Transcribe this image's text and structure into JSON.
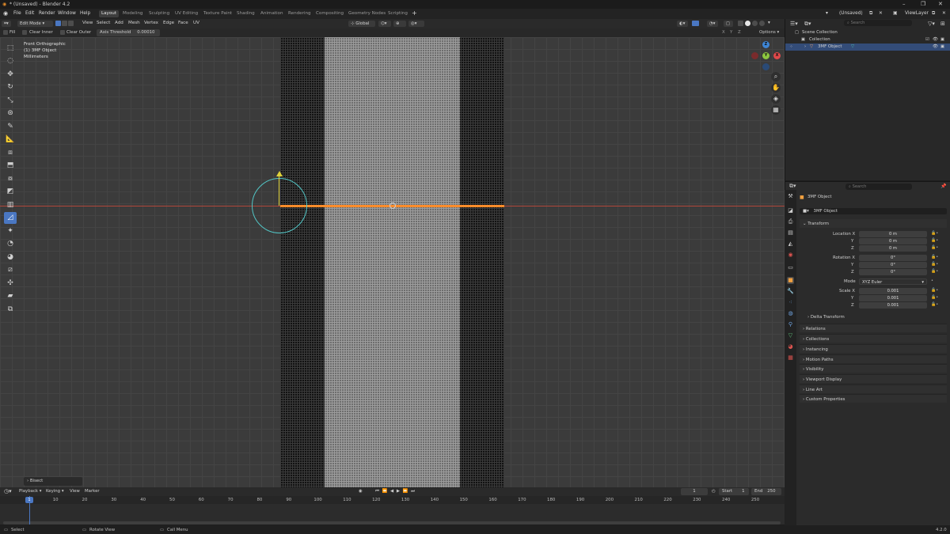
{
  "app": {
    "title": "* (Unsaved) - Blender 4.2",
    "version": "4.2.0"
  },
  "menu": [
    "File",
    "Edit",
    "Render",
    "Window",
    "Help"
  ],
  "workspaces": [
    "Layout",
    "Modeling",
    "Sculpting",
    "UV Editing",
    "Texture Paint",
    "Shading",
    "Animation",
    "Rendering",
    "Compositing",
    "Geometry Nodes",
    "Scripting"
  ],
  "active_workspace": "Layout",
  "scene": {
    "name": "(Unsaved)",
    "view_layer": "ViewLayer"
  },
  "viewport_header": {
    "mode": "Edit Mode",
    "menus": [
      "View",
      "Select",
      "Add",
      "Mesh",
      "Vertex",
      "Edge",
      "Face",
      "UV"
    ],
    "orientation": "Global",
    "options": "Options",
    "axes": [
      "X",
      "Y",
      "Z"
    ]
  },
  "tool_settings": {
    "fill": "Fill",
    "clear_inner": "Clear Inner",
    "clear_outer": "Clear Outer",
    "axis_threshold_label": "Axis Threshold",
    "axis_threshold_value": "0.00010"
  },
  "viewport_info": {
    "view": "Front Orthographic",
    "object": "(1) 3MF Object",
    "units": "Millimeters"
  },
  "operator_panel": "Bisect",
  "nav_axes": {
    "z": "Z",
    "y": "Y",
    "x": "X"
  },
  "timeline": {
    "menus": [
      "Playback",
      "Keying",
      "View",
      "Marker"
    ],
    "current_frame": "1",
    "start_label": "Start",
    "start": "1",
    "end_label": "End",
    "end": "250",
    "ruler": [
      "1",
      "10",
      "20",
      "30",
      "40",
      "50",
      "60",
      "70",
      "80",
      "90",
      "100",
      "110",
      "120",
      "130",
      "140",
      "150",
      "160",
      "170",
      "180",
      "190",
      "200",
      "210",
      "220",
      "230",
      "240",
      "250"
    ]
  },
  "statusbar": {
    "select": "Select",
    "rotate": "Rotate View",
    "call_menu": "Call Menu",
    "version": "4.2.0"
  },
  "outliner": {
    "search_placeholder": "Search",
    "scene_collection": "Scene Collection",
    "collection": "Collection",
    "object": "3MF Object"
  },
  "properties": {
    "search_placeholder": "Search",
    "object_name": "3MF Object",
    "object_field": "3MF Object",
    "transform": "Transform",
    "location_label": "Location X",
    "rotation_label": "Rotation X",
    "scale_label": "Scale X",
    "y_label": "Y",
    "z_label": "Z",
    "location": [
      "0 m",
      "0 m",
      "0 m"
    ],
    "rotation": [
      "0°",
      "0°",
      "0°"
    ],
    "mode_label": "Mode",
    "mode": "XYZ Euler",
    "scale": [
      "0.001",
      "0.001",
      "0.001"
    ],
    "delta": "Delta Transform",
    "sections": [
      "Relations",
      "Collections",
      "Instancing",
      "Motion Paths",
      "Visibility",
      "Viewport Display",
      "Line Art",
      "Custom Properties"
    ]
  },
  "colors": {
    "accent": "#4a77c2",
    "selection": "#ff8c2a",
    "x_axis": "#b2463a"
  }
}
